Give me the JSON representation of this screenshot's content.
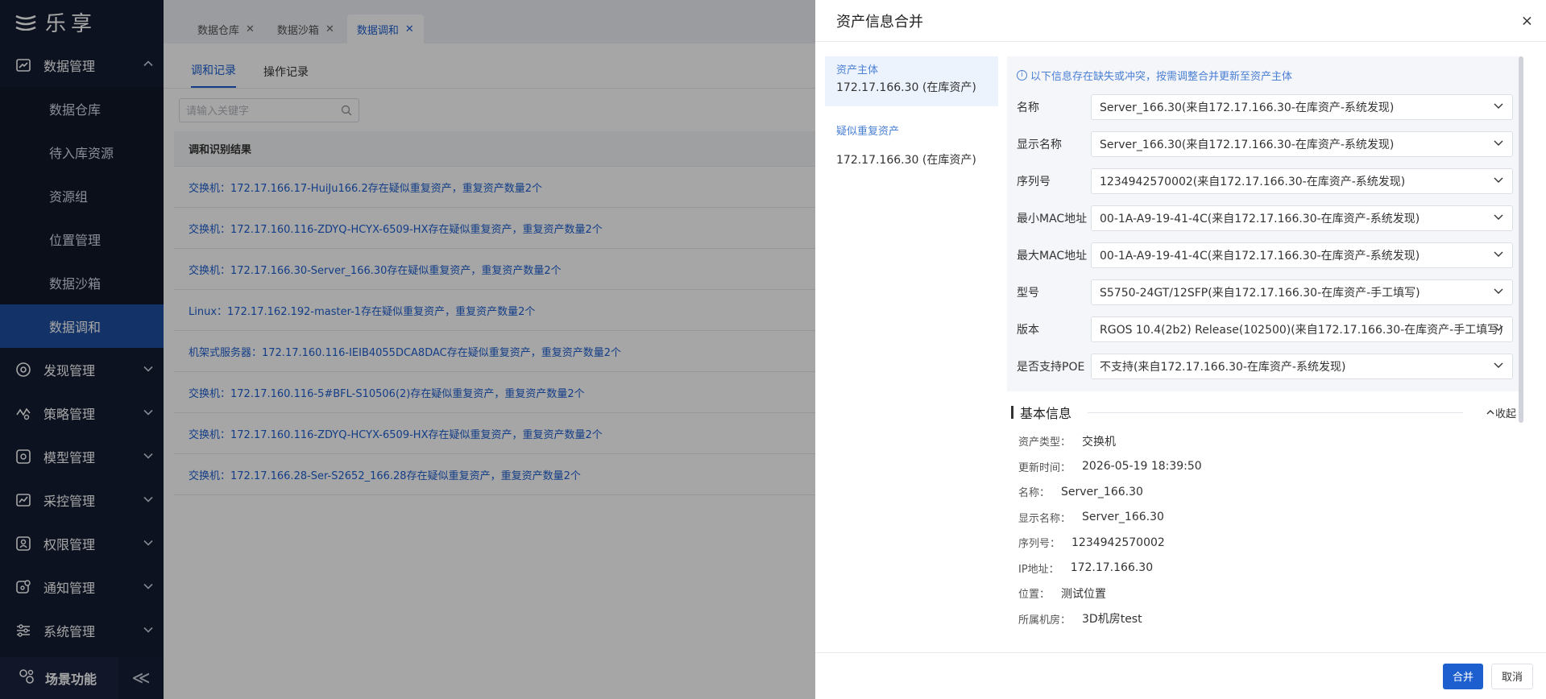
{
  "app": {
    "logo_text": "乐享"
  },
  "sidebar": {
    "groups": [
      {
        "label": "数据管理",
        "icon": "data-management-icon",
        "expanded": true,
        "items": [
          {
            "label": "数据仓库"
          },
          {
            "label": "待入库资源"
          },
          {
            "label": "资源组"
          },
          {
            "label": "位置管理"
          },
          {
            "label": "数据沙箱"
          },
          {
            "label": "数据调和",
            "active": true
          }
        ]
      },
      {
        "label": "发现管理",
        "icon": "discovery-icon"
      },
      {
        "label": "策略管理",
        "icon": "policy-icon"
      },
      {
        "label": "模型管理",
        "icon": "model-icon"
      },
      {
        "label": "采控管理",
        "icon": "collection-icon"
      },
      {
        "label": "权限管理",
        "icon": "permission-icon"
      },
      {
        "label": "通知管理",
        "icon": "notification-icon"
      },
      {
        "label": "系统管理",
        "icon": "system-icon"
      }
    ],
    "bottom": {
      "label": "场景功能",
      "collapse_glyph": "≪"
    }
  },
  "tabs": [
    {
      "label": "数据仓库"
    },
    {
      "label": "数据沙箱"
    },
    {
      "label": "数据调和",
      "active": true
    }
  ],
  "subtabs": [
    {
      "label": "调和记录",
      "active": true
    },
    {
      "label": "操作记录"
    }
  ],
  "search": {
    "placeholder": "请输入关键字"
  },
  "table": {
    "header": "调和识别结果",
    "rows": [
      "交换机：172.17.166.17-HuiJu166.2存在疑似重复资产，重复资产数量2个",
      "交换机：172.17.160.116-ZDYQ-HCYX-6509-HX存在疑似重复资产，重复资产数量2个",
      "交换机：172.17.166.30-Server_166.30存在疑似重复资产，重复资产数量2个",
      "Linux：172.17.162.192-master-1存在疑似重复资产，重复资产数量2个",
      "机架式服务器：172.17.160.116-IEIB4055DCA8DAC存在疑似重复资产，重复资产数量2个",
      "交换机：172.17.160.116-5#BFL-S10506(2)存在疑似重复资产，重复资产数量2个",
      "交换机：172.17.160.116-ZDYQ-HCYX-6509-HX存在疑似重复资产，重复资产数量2个",
      "交换机：172.17.166.28-Ser-S2652_166.28存在疑似重复资产，重复资产数量2个"
    ]
  },
  "drawer": {
    "title": "资产信息合并",
    "close_glyph": "×",
    "left": {
      "primary_label": "资产主体",
      "primary_value": "172.17.166.30 (在库资产)",
      "dup_label": "疑似重复资产",
      "dup_value": "172.17.166.30 (在库资产)"
    },
    "tip": "以下信息存在缺失或冲突，按需调整合并更新至资产主体",
    "fields": [
      {
        "label": "名称",
        "value": "Server_166.30(来自172.17.166.30-在库资产-系统发现)"
      },
      {
        "label": "显示名称",
        "value": "Server_166.30(来自172.17.166.30-在库资产-系统发现)"
      },
      {
        "label": "序列号",
        "value": "1234942570002(来自172.17.166.30-在库资产-系统发现)"
      },
      {
        "label": "最小MAC地址",
        "value": "00-1A-A9-19-41-4C(来自172.17.166.30-在库资产-系统发现)"
      },
      {
        "label": "最大MAC地址",
        "value": "00-1A-A9-19-41-4C(来自172.17.166.30-在库资产-系统发现)"
      },
      {
        "label": "型号",
        "value": "S5750-24GT/12SFP(来自172.17.166.30-在库资产-手工填写)"
      },
      {
        "label": "版本",
        "value": "RGOS 10.4(2b2) Release(102500)(来自172.17.166.30-在库资产-手工填写)"
      },
      {
        "label": "是否支持POE",
        "value": "不支持(来自172.17.166.30-在库资产-系统发现)"
      }
    ],
    "section": {
      "title": "基本信息",
      "collapse_label": "收起"
    },
    "basic_info": [
      {
        "key": "资产类型：",
        "value": "交换机"
      },
      {
        "key": "更新时间：",
        "value": "2026-05-19 18:39:50"
      },
      {
        "key": "名称：",
        "value": "Server_166.30"
      },
      {
        "key": "显示名称：",
        "value": "Server_166.30"
      },
      {
        "key": "序列号：",
        "value": "1234942570002"
      },
      {
        "key": "IP地址：",
        "value": "172.17.166.30"
      },
      {
        "key": "位置：",
        "value": "测试位置"
      },
      {
        "key": "所属机房：",
        "value": "3D机房test"
      }
    ],
    "buttons": {
      "merge": "合并",
      "cancel": "取消"
    }
  },
  "colors": {
    "sidebar_bg": "#151d33",
    "active_bg": "#1e4d9e",
    "accent": "#1e5fd0"
  }
}
